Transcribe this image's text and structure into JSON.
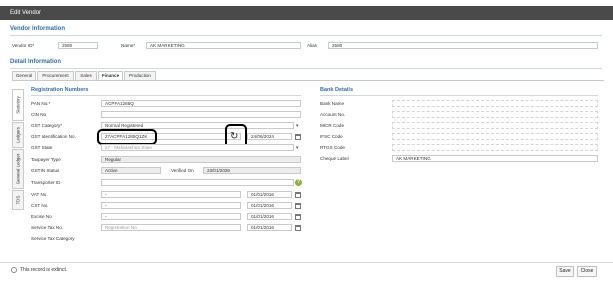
{
  "window": {
    "title": "Edit Vendor"
  },
  "vendor_info": {
    "section_title": "Vendor Information",
    "vendor_id_label": "Vendor ID*",
    "vendor_id_value": "2580",
    "name_label": "Name*",
    "name_value": "AK MARKETING",
    "alias_label": "Alias",
    "alias_value": "2580"
  },
  "detail": {
    "section_title": "Detail Information",
    "tabs": [
      {
        "label": "General"
      },
      {
        "label": "Procurement"
      },
      {
        "label": "Sales"
      },
      {
        "label": "Finance",
        "active": true
      },
      {
        "label": "Production"
      }
    ],
    "side_tabs": [
      {
        "label": "Statutory",
        "active": true
      },
      {
        "label": "Ledgers"
      },
      {
        "label": "General Ledger"
      },
      {
        "label": "TDS"
      }
    ]
  },
  "registration": {
    "title": "Registration Numbers",
    "pan_label": "PAN No.*",
    "pan_value": "ACPFA1285Q",
    "cin_label": "CIN No",
    "cin_value": "",
    "gst_category_label": "GST Category*",
    "gst_category_value": "Normal Registered",
    "gstin_label": "GST Identification No.",
    "gstin_value": "27ACPFA1285Q1ZK",
    "gstin_date": "24/06/2024",
    "gst_state_label": "GST State",
    "gst_state_value": "27 - Maharashtra State",
    "taxpayer_label": "Taxpayer Type",
    "taxpayer_value": "Regular",
    "gstin_status_label": "GSTIN Status",
    "gstin_status_value": "Active",
    "verified_on_label": "Verified On",
    "verified_on_value": "23/01/2026",
    "transporter_label": "Transporter ID",
    "transporter_value": "",
    "vat_label": "VAT No.",
    "vat_value": "-",
    "vat_date": "01/01/2016",
    "cst_label": "CST No.",
    "cst_value": "-",
    "cst_date": "01/01/2016",
    "excise_label": "Excise No",
    "excise_value": "-",
    "excise_date": "01/01/2016",
    "service_tax_label": "Service Tax No.",
    "service_tax_placeholder": "Registration No",
    "service_tax_date": "01/01/2016",
    "service_tax_cat_label": "Service Tax Category"
  },
  "bank": {
    "title": "Bank Details",
    "bank_name_label": "Bank Name",
    "bank_name_value": "",
    "account_no_label": "Account No.",
    "account_no_value": "",
    "micr_label": "MICR Code",
    "micr_value": "",
    "ifsc_label": "IFSC Code",
    "ifsc_value": "",
    "rtgs_label": "RTGS Code",
    "rtgs_value": "",
    "cheque_label": "Cheque Label",
    "cheque_value": "AK MARKETING"
  },
  "footer": {
    "extinct_label": "This record is extinct.",
    "save_label": "Save",
    "close_label": "Close"
  },
  "icons": {
    "refresh": "refresh-icon",
    "calendar": "calendar-icon",
    "dropdown": "chevron-down-icon",
    "help": "help-icon"
  },
  "colors": {
    "titlebar": "#4a4a4a",
    "section_title": "#2f6fb0",
    "help_icon": "#8bb531"
  }
}
